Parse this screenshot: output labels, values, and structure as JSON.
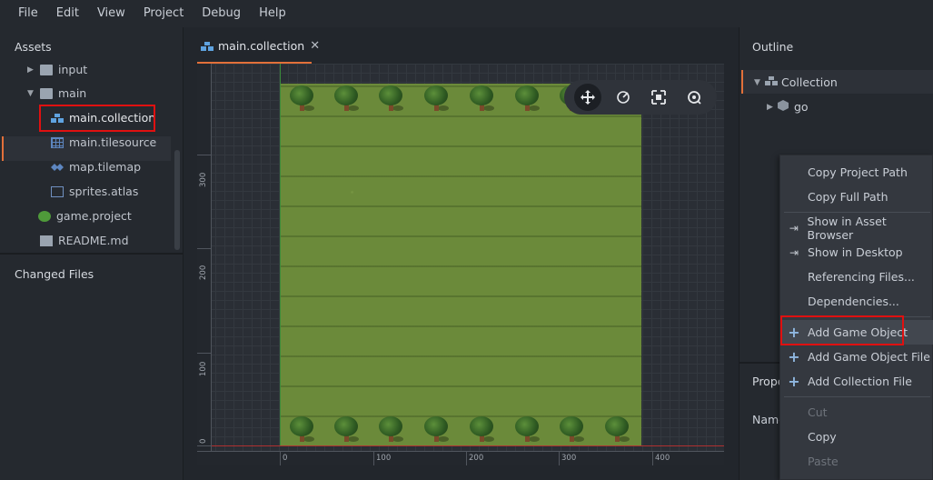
{
  "menubar": {
    "items": [
      "File",
      "Edit",
      "View",
      "Project",
      "Debug",
      "Help"
    ]
  },
  "assets": {
    "title": "Assets",
    "tree": [
      {
        "label": "input",
        "kind": "folder",
        "expanded": false
      },
      {
        "label": "main",
        "kind": "folder",
        "expanded": true
      },
      {
        "label": "main.collection",
        "kind": "collection",
        "selected": true
      },
      {
        "label": "main.tilesource",
        "kind": "tilesource"
      },
      {
        "label": "map.tilemap",
        "kind": "tilemap"
      },
      {
        "label": "sprites.atlas",
        "kind": "atlas"
      },
      {
        "label": "game.project",
        "kind": "project"
      },
      {
        "label": "README.md",
        "kind": "file"
      }
    ]
  },
  "changed_files": {
    "title": "Changed Files"
  },
  "editor": {
    "tab_label": "main.collection",
    "tab_close": "✕",
    "ruler_y": [
      "0",
      "100",
      "200",
      "300"
    ],
    "ruler_x": [
      "0",
      "100",
      "200",
      "300",
      "400"
    ],
    "toolbar": [
      "move-tool",
      "rotate-tool",
      "scale-tool",
      "camera-tool"
    ]
  },
  "outline": {
    "title": "Outline",
    "items": [
      {
        "label": "Collection",
        "expanded": true,
        "selected": true
      },
      {
        "label": "go",
        "expanded": false
      }
    ]
  },
  "properties": {
    "title": "Prope",
    "name_label": "Name"
  },
  "context_menu": {
    "items": [
      {
        "label": "Copy Project Path",
        "icon": "",
        "enabled": true
      },
      {
        "label": "Copy Full Path",
        "icon": "",
        "enabled": true
      },
      {
        "label": "Show in Asset Browser",
        "icon": "⇥",
        "enabled": true
      },
      {
        "label": "Show in Desktop",
        "icon": "⇥",
        "enabled": true
      },
      {
        "label": "Referencing Files...",
        "icon": "",
        "enabled": true
      },
      {
        "label": "Dependencies...",
        "icon": "",
        "enabled": true
      },
      {
        "label": "Add Game Object",
        "icon": "+",
        "enabled": true,
        "highlighted": true
      },
      {
        "label": "Add Game Object File",
        "icon": "+",
        "enabled": true
      },
      {
        "label": "Add Collection File",
        "icon": "+",
        "enabled": true
      },
      {
        "label": "Cut",
        "icon": "",
        "enabled": false
      },
      {
        "label": "Copy",
        "icon": "",
        "enabled": true
      },
      {
        "label": "Paste",
        "icon": "",
        "enabled": false
      }
    ]
  },
  "colors": {
    "accent": "#e2703a",
    "highlight_box": "#e01010",
    "plus_icon": "#8fb7e0"
  }
}
